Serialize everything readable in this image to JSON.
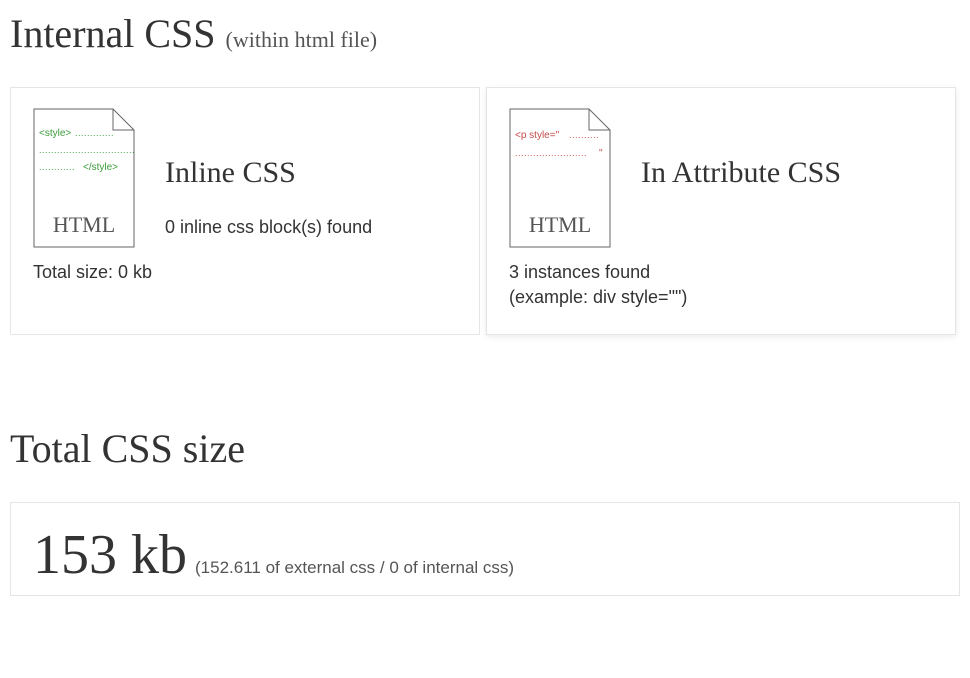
{
  "section1": {
    "title": "Internal CSS",
    "subtitle": "(within html file)"
  },
  "card_inline": {
    "heading": "Inline CSS",
    "desc": "0 inline css block(s) found",
    "footer": "Total size: 0 kb",
    "icon": {
      "line1": "<style>................",
      "line2": "...................................",
      "line3": ".............</style>",
      "label": "HTML"
    }
  },
  "card_attr": {
    "heading": "In Attribute CSS",
    "desc": "",
    "footer_line1": "3 instances found",
    "footer_line2": "(example: div style=\"\")",
    "icon": {
      "line1": "<p style=\"...........",
      "line2": "........................\"",
      "label": "HTML"
    }
  },
  "section2": {
    "title": "Total CSS size",
    "value": "153 kb",
    "detail": "(152.611 of external css / 0 of internal css)"
  }
}
